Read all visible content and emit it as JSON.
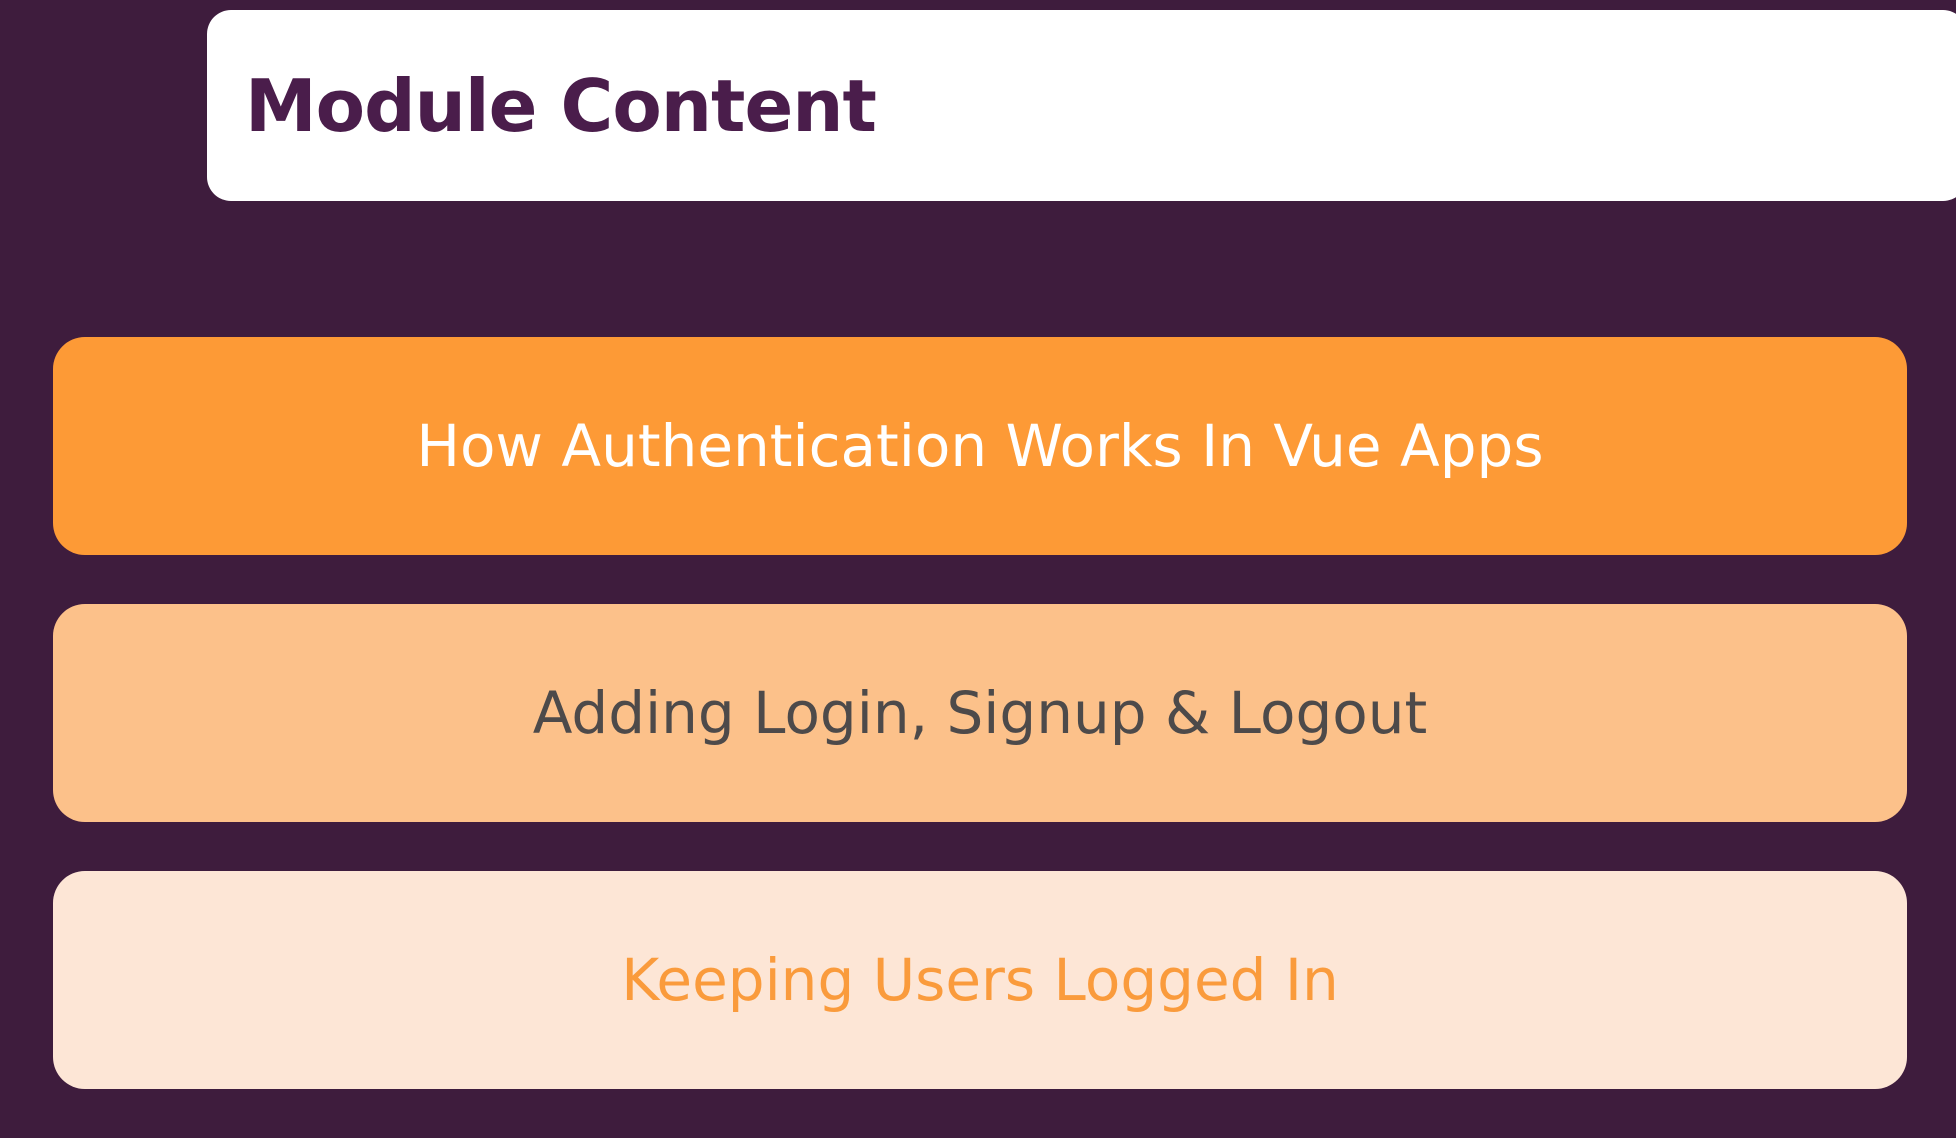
{
  "header": {
    "title": "Module Content"
  },
  "colors": {
    "background": "#3e1c3d",
    "title_text": "#4a1d4b",
    "header_bg": "#ffffff"
  },
  "items": [
    {
      "label": "How Authentication Works In Vue Apps",
      "bg": "#fd9a36",
      "text_color": "#ffffff"
    },
    {
      "label": "Adding Login, Signup & Logout",
      "bg": "#fcc18a",
      "text_color": "#4d4a4a"
    },
    {
      "label": "Keeping Users Logged In",
      "bg": "#fde6d6",
      "text_color": "#fa9b3c"
    }
  ]
}
